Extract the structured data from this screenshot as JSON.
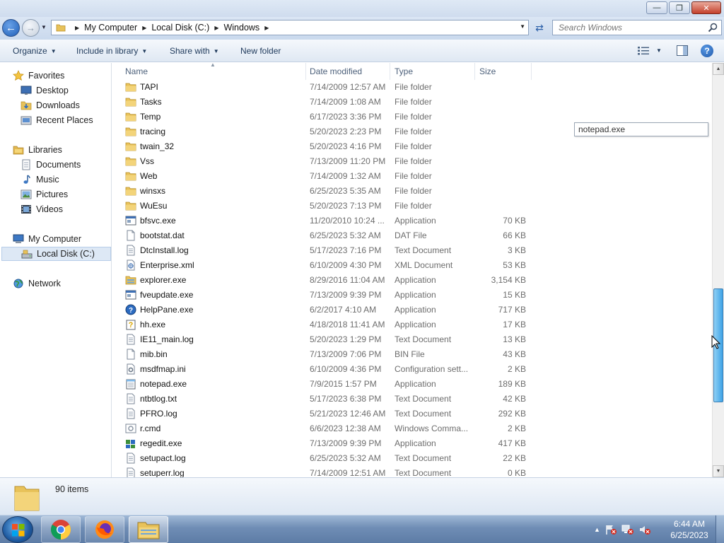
{
  "window": {
    "minimize_glyph": "—",
    "maximize_glyph": "❐",
    "close_glyph": "✕"
  },
  "address": {
    "crumbs": [
      "My Computer",
      "Local Disk (C:)",
      "Windows"
    ],
    "search_placeholder": "Search Windows"
  },
  "toolbar": {
    "organize": "Organize",
    "include_in_library": "Include in library",
    "share_with": "Share with",
    "new_folder": "New folder",
    "help": "?"
  },
  "nav": {
    "favorites": "Favorites",
    "desktop": "Desktop",
    "downloads": "Downloads",
    "recent_places": "Recent Places",
    "libraries": "Libraries",
    "documents": "Documents",
    "music": "Music",
    "pictures": "Pictures",
    "videos": "Videos",
    "my_computer": "My Computer",
    "local_disk": "Local Disk (C:)",
    "network": "Network"
  },
  "columns": {
    "name": "Name",
    "date_modified": "Date modified",
    "type": "Type",
    "size": "Size"
  },
  "files": [
    {
      "name": "TAPI",
      "date": "7/14/2009 12:57 AM",
      "type": "File folder",
      "size": "",
      "icon": "folder-icon"
    },
    {
      "name": "Tasks",
      "date": "7/14/2009 1:08 AM",
      "type": "File folder",
      "size": "",
      "icon": "folder-icon"
    },
    {
      "name": "Temp",
      "date": "6/17/2023 3:36 PM",
      "type": "File folder",
      "size": "",
      "icon": "folder-icon"
    },
    {
      "name": "tracing",
      "date": "5/20/2023 2:23 PM",
      "type": "File folder",
      "size": "",
      "icon": "folder-icon"
    },
    {
      "name": "twain_32",
      "date": "5/20/2023 4:16 PM",
      "type": "File folder",
      "size": "",
      "icon": "folder-icon"
    },
    {
      "name": "Vss",
      "date": "7/13/2009 11:20 PM",
      "type": "File folder",
      "size": "",
      "icon": "folder-icon"
    },
    {
      "name": "Web",
      "date": "7/14/2009 1:32 AM",
      "type": "File folder",
      "size": "",
      "icon": "folder-icon"
    },
    {
      "name": "winsxs",
      "date": "6/25/2023 5:35 AM",
      "type": "File folder",
      "size": "",
      "icon": "folder-icon"
    },
    {
      "name": "WuEsu",
      "date": "5/20/2023 7:13 PM",
      "type": "File folder",
      "size": "",
      "icon": "folder-icon"
    },
    {
      "name": "bfsvc.exe",
      "date": "11/20/2010 10:24 ...",
      "type": "Application",
      "size": "70 KB",
      "icon": "application-icon"
    },
    {
      "name": "bootstat.dat",
      "date": "6/25/2023 5:32 AM",
      "type": "DAT File",
      "size": "66 KB",
      "icon": "file-icon"
    },
    {
      "name": "DtcInstall.log",
      "date": "5/17/2023 7:16 PM",
      "type": "Text Document",
      "size": "3 KB",
      "icon": "text-document-icon"
    },
    {
      "name": "Enterprise.xml",
      "date": "6/10/2009 4:30 PM",
      "type": "XML Document",
      "size": "53 KB",
      "icon": "xml-document-icon"
    },
    {
      "name": "explorer.exe",
      "date": "8/29/2016 11:04 AM",
      "type": "Application",
      "size": "3,154 KB",
      "icon": "explorer-app-icon"
    },
    {
      "name": "fveupdate.exe",
      "date": "7/13/2009 9:39 PM",
      "type": "Application",
      "size": "15 KB",
      "icon": "application-icon"
    },
    {
      "name": "HelpPane.exe",
      "date": "6/2/2017 4:10 AM",
      "type": "Application",
      "size": "717 KB",
      "icon": "help-app-icon"
    },
    {
      "name": "hh.exe",
      "date": "4/18/2018 11:41 AM",
      "type": "Application",
      "size": "17 KB",
      "icon": "help-file-app-icon"
    },
    {
      "name": "IE11_main.log",
      "date": "5/20/2023 1:29 PM",
      "type": "Text Document",
      "size": "13 KB",
      "icon": "text-document-icon"
    },
    {
      "name": "mib.bin",
      "date": "7/13/2009 7:06 PM",
      "type": "BIN File",
      "size": "43 KB",
      "icon": "file-icon"
    },
    {
      "name": "msdfmap.ini",
      "date": "6/10/2009 4:36 PM",
      "type": "Configuration sett...",
      "size": "2 KB",
      "icon": "config-file-icon"
    },
    {
      "name": "notepad.exe",
      "date": "7/9/2015 1:57 PM",
      "type": "Application",
      "size": "189 KB",
      "icon": "notepad-app-icon"
    },
    {
      "name": "ntbtlog.txt",
      "date": "5/17/2023 6:38 PM",
      "type": "Text Document",
      "size": "42 KB",
      "icon": "text-document-icon"
    },
    {
      "name": "PFRO.log",
      "date": "5/21/2023 12:46 AM",
      "type": "Text Document",
      "size": "292 KB",
      "icon": "text-document-icon"
    },
    {
      "name": "r.cmd",
      "date": "6/6/2023 12:38 AM",
      "type": "Windows Comma...",
      "size": "2 KB",
      "icon": "cmd-file-icon"
    },
    {
      "name": "regedit.exe",
      "date": "7/13/2009 9:39 PM",
      "type": "Application",
      "size": "417 KB",
      "icon": "regedit-app-icon"
    },
    {
      "name": "setupact.log",
      "date": "6/25/2023 5:32 AM",
      "type": "Text Document",
      "size": "22 KB",
      "icon": "text-document-icon"
    },
    {
      "name": "setuperr.log",
      "date": "7/14/2009 12:51 AM",
      "type": "Text Document",
      "size": "0 KB",
      "icon": "text-document-icon"
    }
  ],
  "floating_box": {
    "text": "notepad.exe"
  },
  "details": {
    "item_count": "90 items"
  },
  "taskbar": {
    "time": "6:44 AM",
    "date": "6/25/2023"
  }
}
